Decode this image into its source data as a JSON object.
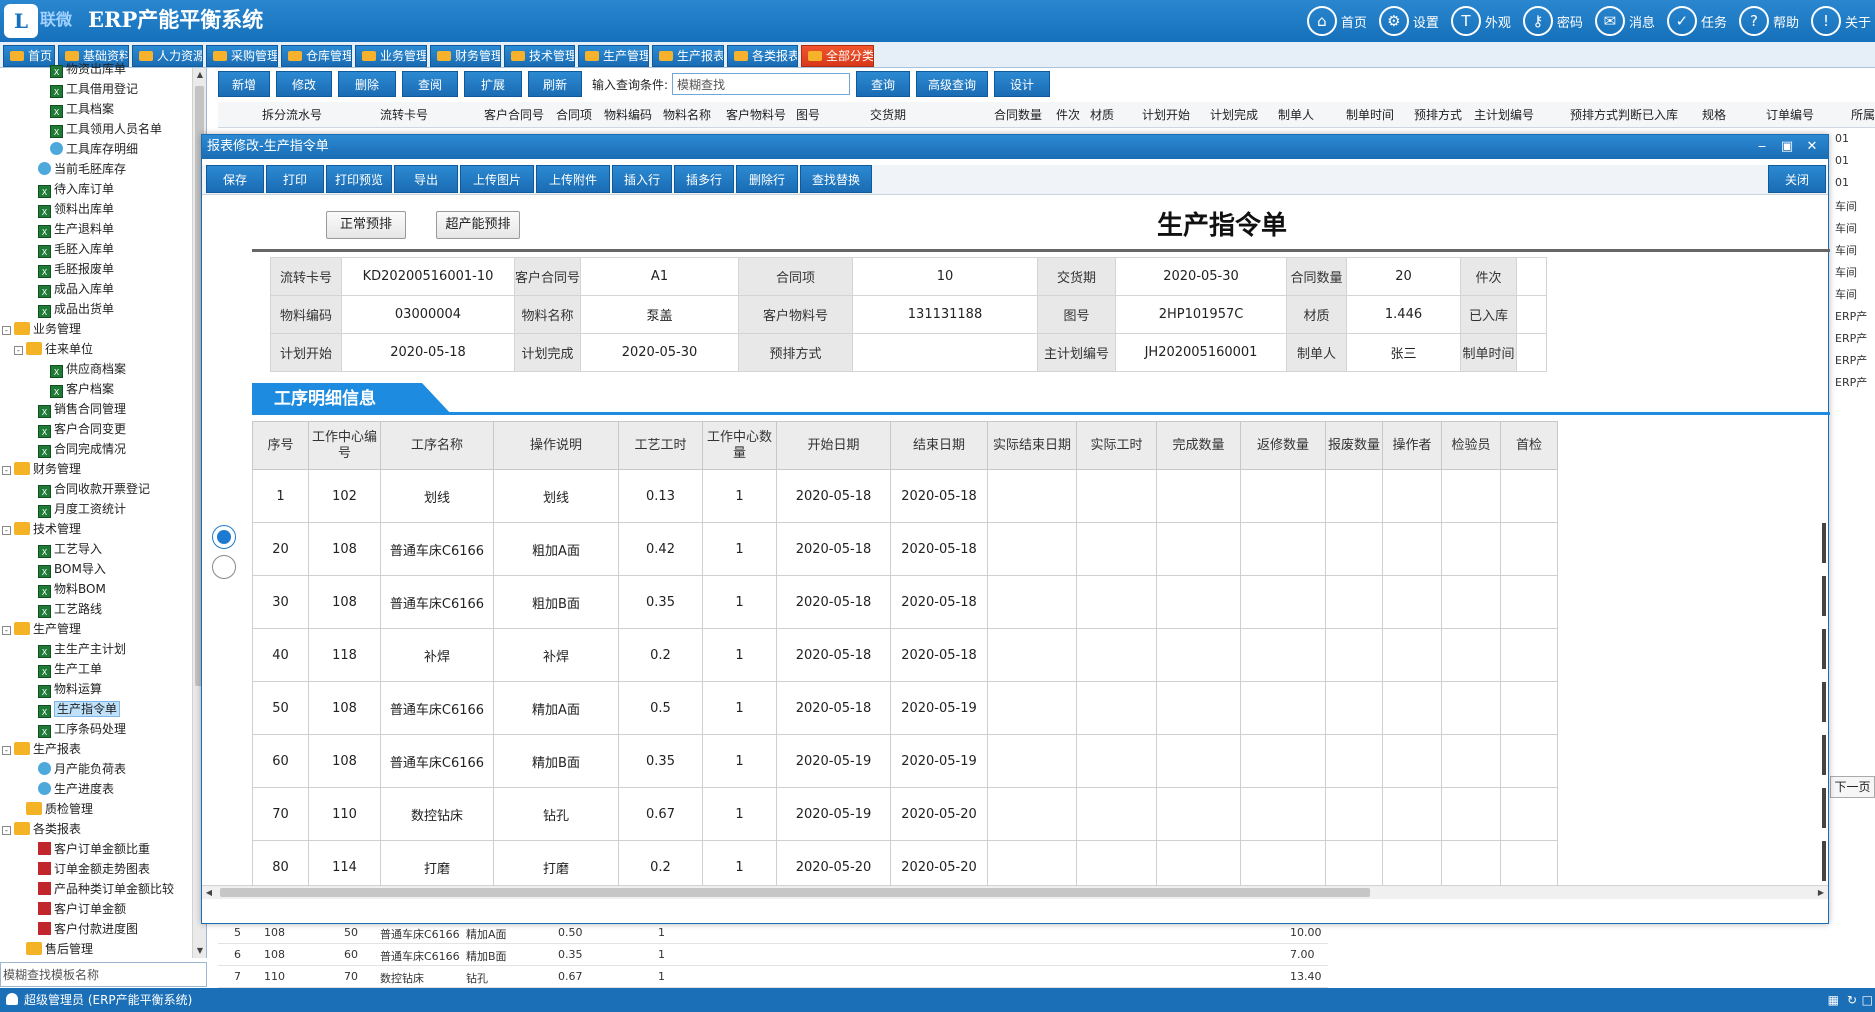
{
  "app": {
    "logo_mark": "L",
    "brand": "联微",
    "title": "ERP产能平衡系统"
  },
  "topnav": [
    {
      "icon": "home-icon",
      "glyph": "⌂",
      "label": "首页"
    },
    {
      "icon": "gear-icon",
      "glyph": "⚙",
      "label": "设置"
    },
    {
      "icon": "shirt-icon",
      "glyph": "T",
      "label": "外观"
    },
    {
      "icon": "key-icon",
      "glyph": "⚷",
      "label": "密码"
    },
    {
      "icon": "mail-icon",
      "glyph": "✉",
      "label": "消息"
    },
    {
      "icon": "task-icon",
      "glyph": "✓",
      "label": "任务"
    },
    {
      "icon": "help-icon",
      "glyph": "?",
      "label": "帮助"
    },
    {
      "icon": "info-icon",
      "glyph": "!",
      "label": "关于"
    }
  ],
  "menu_tabs": [
    "首页",
    "基础资料",
    "人力资源",
    "采购管理",
    "仓库管理",
    "业务管理",
    "财务管理",
    "技术管理",
    "生产管理",
    "生产报表",
    "各类报表",
    "全部分类"
  ],
  "sidebar": {
    "items": [
      {
        "label": "物资出库单",
        "icon": "x",
        "indent": 3
      },
      {
        "label": "工具借用登记",
        "icon": "x",
        "indent": 3
      },
      {
        "label": "工具档案",
        "icon": "x",
        "indent": 3
      },
      {
        "label": "工具领用人员名单",
        "icon": "x",
        "indent": 3
      },
      {
        "label": "工具库存明细",
        "icon": "r",
        "indent": 3
      },
      {
        "label": "当前毛胚库存",
        "icon": "r",
        "indent": 2
      },
      {
        "label": "待入库订单",
        "icon": "x",
        "indent": 2
      },
      {
        "label": "领料出库单",
        "icon": "x",
        "indent": 2
      },
      {
        "label": "生产退料单",
        "icon": "x",
        "indent": 2
      },
      {
        "label": "毛胚入库单",
        "icon": "x",
        "indent": 2
      },
      {
        "label": "毛胚报废单",
        "icon": "x",
        "indent": 2
      },
      {
        "label": "成品入库单",
        "icon": "x",
        "indent": 2
      },
      {
        "label": "成品出货单",
        "icon": "x",
        "indent": 2
      },
      {
        "label": "业务管理",
        "icon": "f",
        "indent": 0,
        "toggle": "-"
      },
      {
        "label": "往来单位",
        "icon": "f",
        "indent": 1,
        "toggle": "-"
      },
      {
        "label": "供应商档案",
        "icon": "x",
        "indent": 3
      },
      {
        "label": "客户档案",
        "icon": "x",
        "indent": 3
      },
      {
        "label": "销售合同管理",
        "icon": "x",
        "indent": 2
      },
      {
        "label": "客户合同变更",
        "icon": "x",
        "indent": 2
      },
      {
        "label": "合同完成情况",
        "icon": "x",
        "indent": 2
      },
      {
        "label": "财务管理",
        "icon": "f",
        "indent": 0,
        "toggle": "-"
      },
      {
        "label": "合同收款开票登记",
        "icon": "x",
        "indent": 2
      },
      {
        "label": "月度工资统计",
        "icon": "x",
        "indent": 2
      },
      {
        "label": "技术管理",
        "icon": "f",
        "indent": 0,
        "toggle": "-"
      },
      {
        "label": "工艺导入",
        "icon": "x",
        "indent": 2
      },
      {
        "label": "BOM导入",
        "icon": "x",
        "indent": 2
      },
      {
        "label": "物料BOM",
        "icon": "x",
        "indent": 2
      },
      {
        "label": "工艺路线",
        "icon": "x",
        "indent": 2
      },
      {
        "label": "生产管理",
        "icon": "f",
        "indent": 0,
        "toggle": "-"
      },
      {
        "label": "主生产主计划",
        "icon": "x",
        "indent": 2
      },
      {
        "label": "生产工单",
        "icon": "x",
        "indent": 2
      },
      {
        "label": "物料运算",
        "icon": "x",
        "indent": 2
      },
      {
        "label": "生产指令单",
        "icon": "x",
        "indent": 2,
        "selected": true
      },
      {
        "label": "工序条码处理",
        "icon": "x",
        "indent": 2
      },
      {
        "label": "生产报表",
        "icon": "f",
        "indent": 0,
        "toggle": "-"
      },
      {
        "label": "月产能负荷表",
        "icon": "r",
        "indent": 2
      },
      {
        "label": "生产进度表",
        "icon": "r",
        "indent": 2
      },
      {
        "label": "质检管理",
        "icon": "f",
        "indent": 1
      },
      {
        "label": "各类报表",
        "icon": "f",
        "indent": 0,
        "toggle": "-"
      },
      {
        "label": "客户订单金额比重",
        "icon": "c",
        "indent": 2
      },
      {
        "label": "订单金额走势图表",
        "icon": "c",
        "indent": 2
      },
      {
        "label": "产品种类订单金额比较",
        "icon": "c",
        "indent": 2
      },
      {
        "label": "客户订单金额",
        "icon": "c",
        "indent": 2
      },
      {
        "label": "客户付款进度图",
        "icon": "c",
        "indent": 2
      },
      {
        "label": "售后管理",
        "icon": "f",
        "indent": 1
      }
    ],
    "search_placeholder": "模糊查找模板名称"
  },
  "bg_toolbar": {
    "buttons": [
      "新增",
      "修改",
      "删除",
      "查阅",
      "扩展",
      "刷新"
    ],
    "label": "输入查询条件:",
    "search_placeholder": "模糊查找",
    "buttons2": [
      "查询",
      "高级查询",
      "设计"
    ]
  },
  "bg_headers": [
    "拆分流水号",
    "流转卡号",
    "客户合同号",
    "合同项",
    "物料编码",
    "物料名称",
    "客户物料号",
    "图号",
    "交货期",
    "合同数量",
    "件次",
    "材质",
    "计划开始",
    "计划完成",
    "制单人",
    "制单时间",
    "预排方式",
    "主计划编号",
    "预排方式判断",
    "已入库",
    "规格",
    "订单编号",
    "所属"
  ],
  "bg_right": [
    "01",
    "01",
    "01",
    "车间",
    "车间",
    "车间",
    "车间",
    "车间",
    "ERP产",
    "ERP产",
    "ERP产",
    "ERP产"
  ],
  "bg_next": "下一页",
  "bg_bottom": [
    [
      "5",
      "108",
      "50",
      "普通车床C6166",
      "精加A面",
      "0.50",
      "1",
      "10.00"
    ],
    [
      "6",
      "108",
      "60",
      "普通车床C6166",
      "精加B面",
      "0.35",
      "1",
      "7.00"
    ],
    [
      "7",
      "110",
      "70",
      "数控钻床",
      "钻孔",
      "0.67",
      "1",
      "13.40"
    ]
  ],
  "status": {
    "user": "超级管理员 (ERP产能平衡系统)"
  },
  "dialog": {
    "title": "报表修改-生产指令单",
    "tools": [
      "保存",
      "打印",
      "打印预览",
      "导出",
      "上传图片",
      "上传附件",
      "插入行",
      "插多行",
      "删除行",
      "查找替换"
    ],
    "close": "关闭",
    "btn_normal": "正常预排",
    "btn_over": "超产能预排",
    "doc_title": "生产指令单",
    "header_rows": [
      [
        [
          "流转卡号",
          "KD20200516001-10"
        ],
        [
          "客户合同号",
          "A1"
        ],
        [
          "合同项",
          "10"
        ],
        [
          "交货期",
          "2020-05-30"
        ],
        [
          "合同数量",
          "20"
        ],
        [
          "件次",
          ""
        ]
      ],
      [
        [
          "物料编码",
          "03000004"
        ],
        [
          "物料名称",
          "泵盖"
        ],
        [
          "客户物料号",
          "131131188"
        ],
        [
          "图号",
          "2HP101957C"
        ],
        [
          "材质",
          "1.446"
        ],
        [
          "已入库",
          ""
        ]
      ],
      [
        [
          "计划开始",
          "2020-05-18"
        ],
        [
          "计划完成",
          "2020-05-30"
        ],
        [
          "预排方式",
          ""
        ],
        [
          "主计划编号",
          "JH202005160001"
        ],
        [
          "制单人",
          "张三"
        ],
        [
          "制单时间",
          ""
        ]
      ]
    ],
    "section_title": "工序明细信息",
    "grid_headers": [
      "序号",
      "工作中心编号",
      "工序名称",
      "操作说明",
      "工艺工时",
      "工作中心数量",
      "开始日期",
      "结束日期",
      "实际结束日期",
      "实际工时",
      "完成数量",
      "返修数量",
      "报废数量",
      "操作者",
      "检验员",
      "首检"
    ],
    "grid_rows": [
      [
        "1",
        "102",
        "划线",
        "划线",
        "0.13",
        "1",
        "2020-05-18",
        "2020-05-18",
        "",
        "",
        "",
        "",
        "",
        "",
        "",
        ""
      ],
      [
        "20",
        "108",
        "普通车床C6166",
        "粗加A面",
        "0.42",
        "1",
        "2020-05-18",
        "2020-05-18",
        "",
        "",
        "",
        "",
        "",
        "",
        "",
        ""
      ],
      [
        "30",
        "108",
        "普通车床C6166",
        "粗加B面",
        "0.35",
        "1",
        "2020-05-18",
        "2020-05-18",
        "",
        "",
        "",
        "",
        "",
        "",
        "",
        ""
      ],
      [
        "40",
        "118",
        "补焊",
        "补焊",
        "0.2",
        "1",
        "2020-05-18",
        "2020-05-18",
        "",
        "",
        "",
        "",
        "",
        "",
        "",
        ""
      ],
      [
        "50",
        "108",
        "普通车床C6166",
        "精加A面",
        "0.5",
        "1",
        "2020-05-18",
        "2020-05-19",
        "",
        "",
        "",
        "",
        "",
        "",
        "",
        ""
      ],
      [
        "60",
        "108",
        "普通车床C6166",
        "精加B面",
        "0.35",
        "1",
        "2020-05-19",
        "2020-05-19",
        "",
        "",
        "",
        "",
        "",
        "",
        "",
        ""
      ],
      [
        "70",
        "110",
        "数控钻床",
        "钻孔",
        "0.67",
        "1",
        "2020-05-19",
        "2020-05-20",
        "",
        "",
        "",
        "",
        "",
        "",
        "",
        ""
      ],
      [
        "80",
        "114",
        "打磨",
        "打磨",
        "0.2",
        "1",
        "2020-05-20",
        "2020-05-20",
        "",
        "",
        "",
        "",
        "",
        "",
        "",
        ""
      ]
    ]
  }
}
